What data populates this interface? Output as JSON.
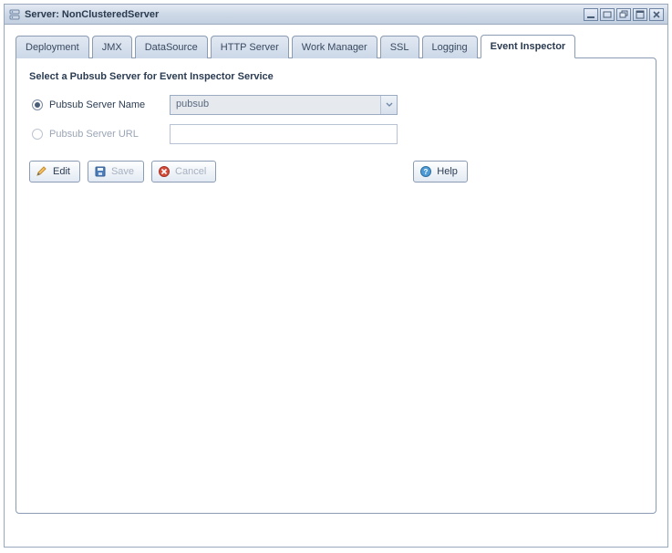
{
  "window": {
    "title_prefix": "Server:",
    "title_value": "NonClusteredServer"
  },
  "tabs": [
    {
      "label": "Deployment"
    },
    {
      "label": "JMX"
    },
    {
      "label": "DataSource"
    },
    {
      "label": "HTTP Server"
    },
    {
      "label": "Work Manager"
    },
    {
      "label": "SSL"
    },
    {
      "label": "Logging"
    },
    {
      "label": "Event Inspector"
    }
  ],
  "active_tab_index": 7,
  "panel": {
    "heading": "Select a Pubsub Server for Event Inspector Service",
    "options": {
      "name": {
        "label": "Pubsub Server Name",
        "selected": true,
        "value": "pubsub"
      },
      "url": {
        "label": "Pubsub Server URL",
        "selected": false,
        "value": ""
      }
    }
  },
  "buttons": {
    "edit": "Edit",
    "save": "Save",
    "cancel": "Cancel",
    "help": "Help"
  }
}
